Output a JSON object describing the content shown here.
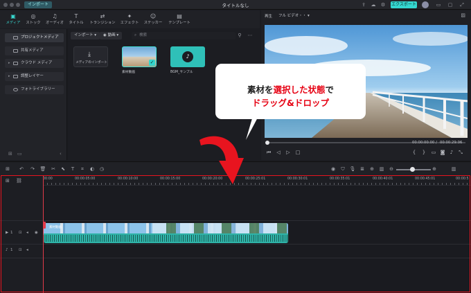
{
  "titlebar": {
    "import_label": "インポート",
    "title": "タイトルなし",
    "export_label": "エクスポート"
  },
  "toolbar": {
    "tabs": [
      {
        "label": "メディア",
        "icon": "media-icon"
      },
      {
        "label": "ストック",
        "icon": "stock-icon"
      },
      {
        "label": "オーディオ",
        "icon": "audio-icon"
      },
      {
        "label": "タイトル",
        "icon": "title-icon"
      },
      {
        "label": "トランジション",
        "icon": "transition-icon"
      },
      {
        "label": "エフェクト",
        "icon": "effect-icon"
      },
      {
        "label": "ステッカー",
        "icon": "sticker-icon"
      },
      {
        "label": "テンプレート",
        "icon": "template-icon"
      }
    ]
  },
  "sidebar": {
    "items": [
      {
        "label": "プロジェクトメディア"
      },
      {
        "label": "共有メディア"
      },
      {
        "label": "クラウド メディア"
      },
      {
        "label": "調整レイヤー"
      },
      {
        "label": "フォトライブラリー"
      }
    ]
  },
  "media": {
    "import_dropdown": "インポート",
    "filter_label": "動画",
    "search_placeholder": "検索",
    "cards": [
      {
        "label": "メディアのインポート"
      },
      {
        "label": "素材動画"
      },
      {
        "label": "BGM_サンプル"
      }
    ]
  },
  "preview": {
    "tab_label": "再生",
    "quality": "フル ビデオ・・",
    "current_time": "00:00:00:00",
    "separator": "/",
    "total_time": "00:00:29:06"
  },
  "callout": {
    "line1_a": "素材を",
    "line1_b": "選択した状態",
    "line1_c": "で",
    "line2": "ドラッグ&ドロップ"
  },
  "timeline": {
    "ruler_labels": [
      "00:00",
      "00:00:05:00",
      "00:00:10:00",
      "00:00:15:00",
      "00:00:20:00",
      "00:00:25:01",
      "00:00:30:01",
      "00:00:35:01",
      "00:00:40:01",
      "00:00:45:01",
      "00:00:5"
    ],
    "video_track_label": "1",
    "audio_track_label": "1",
    "clip_label": "素材動画"
  },
  "colors": {
    "accent": "#34d6cf",
    "highlight_red": "#e60012",
    "frame_red": "#e8141f"
  }
}
